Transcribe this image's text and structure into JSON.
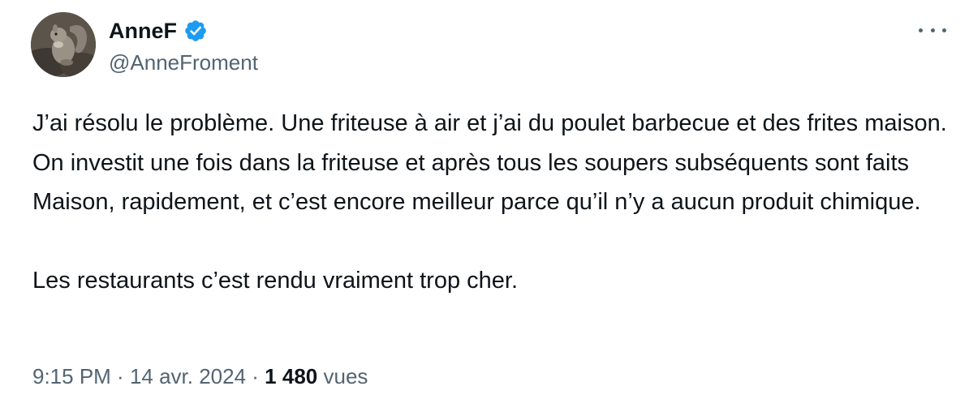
{
  "author": {
    "display_name": "AnneF",
    "handle": "@AnneFroment",
    "verified": true,
    "verified_color": "#1d9bf0"
  },
  "icons": {
    "avatar": "squirrel-photo",
    "badge": "verified-badge-icon",
    "more": "more-options-icon"
  },
  "tweet": {
    "paragraphs": [
      "J’ai résolu le problème. Une friteuse à air et j’ai du poulet barbecue et des frites maison. On investit une fois dans la friteuse et après tous les soupers subséquents sont faits Maison, rapidement, et c’est encore meilleur parce qu’il n’y a aucun produit chimique.",
      "Les restaurants c’est rendu vraiment trop cher."
    ]
  },
  "meta": {
    "time": "9:15 PM",
    "separator": " · ",
    "date": "14 avr. 2024",
    "views_count": "1 480",
    "views_label": "vues"
  },
  "colors": {
    "text": "#0f1419",
    "secondary": "#536471",
    "accent": "#1d9bf0"
  }
}
